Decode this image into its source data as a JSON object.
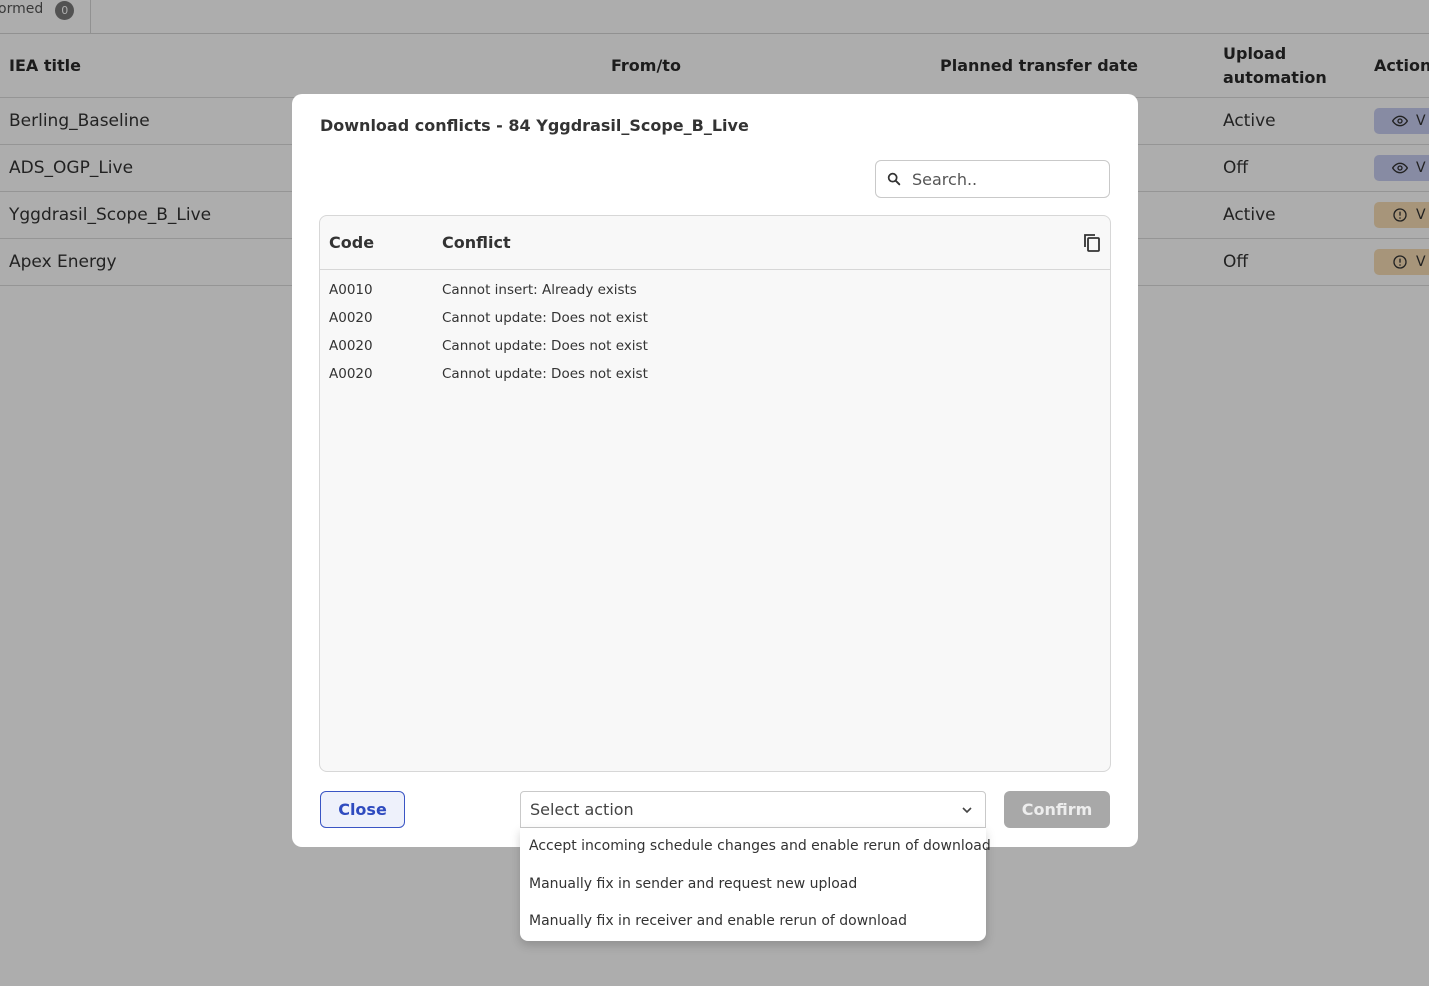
{
  "tabs": {
    "partial_label": "ormed",
    "partial_count": "0"
  },
  "table": {
    "headers": {
      "title": "IEA title",
      "from_to": "From/to",
      "planned_date": "Planned transfer date",
      "upload_automation": "Upload automation",
      "action": "Action"
    },
    "rows": [
      {
        "title": "Berling_Baseline",
        "automation": "Active",
        "action_label": "V",
        "action_icon": "eye-icon",
        "action_color": "#c8cdf0"
      },
      {
        "title": "ADS_OGP_Live",
        "automation": "Off",
        "action_label": "V",
        "action_icon": "eye-icon",
        "action_color": "#c8cdf0"
      },
      {
        "title": "Yggdrasil_Scope_B_Live",
        "automation": "Active",
        "action_label": "V",
        "action_icon": "alert-circle-icon",
        "action_color": "#f6dcb4"
      },
      {
        "title": "Apex Energy",
        "automation": "Off",
        "action_label": "V",
        "action_icon": "alert-circle-icon",
        "action_color": "#f6dcb4"
      }
    ]
  },
  "modal": {
    "title": "Download conflicts - 84 Yggdrasil_Scope_B_Live",
    "search_placeholder": "Search..",
    "columns": {
      "code": "Code",
      "conflict": "Conflict"
    },
    "conflicts": [
      {
        "code": "A0010",
        "message": "Cannot insert: Already exists"
      },
      {
        "code": "A0020",
        "message": "Cannot update: Does not exist"
      },
      {
        "code": "A0020",
        "message": "Cannot update: Does not exist"
      },
      {
        "code": "A0020",
        "message": "Cannot update: Does not exist"
      }
    ],
    "close_label": "Close",
    "select_placeholder": "Select action",
    "confirm_label": "Confirm",
    "options": [
      "Accept incoming schedule changes and enable rerun of download",
      "Manually fix in sender and request new upload",
      "Manually fix in receiver and enable rerun of download"
    ]
  },
  "colors": {
    "accent": "#2f4bbf",
    "confirm_disabled": "#a8a8a8",
    "overlay": "rgba(0,0,0,0.32)"
  }
}
